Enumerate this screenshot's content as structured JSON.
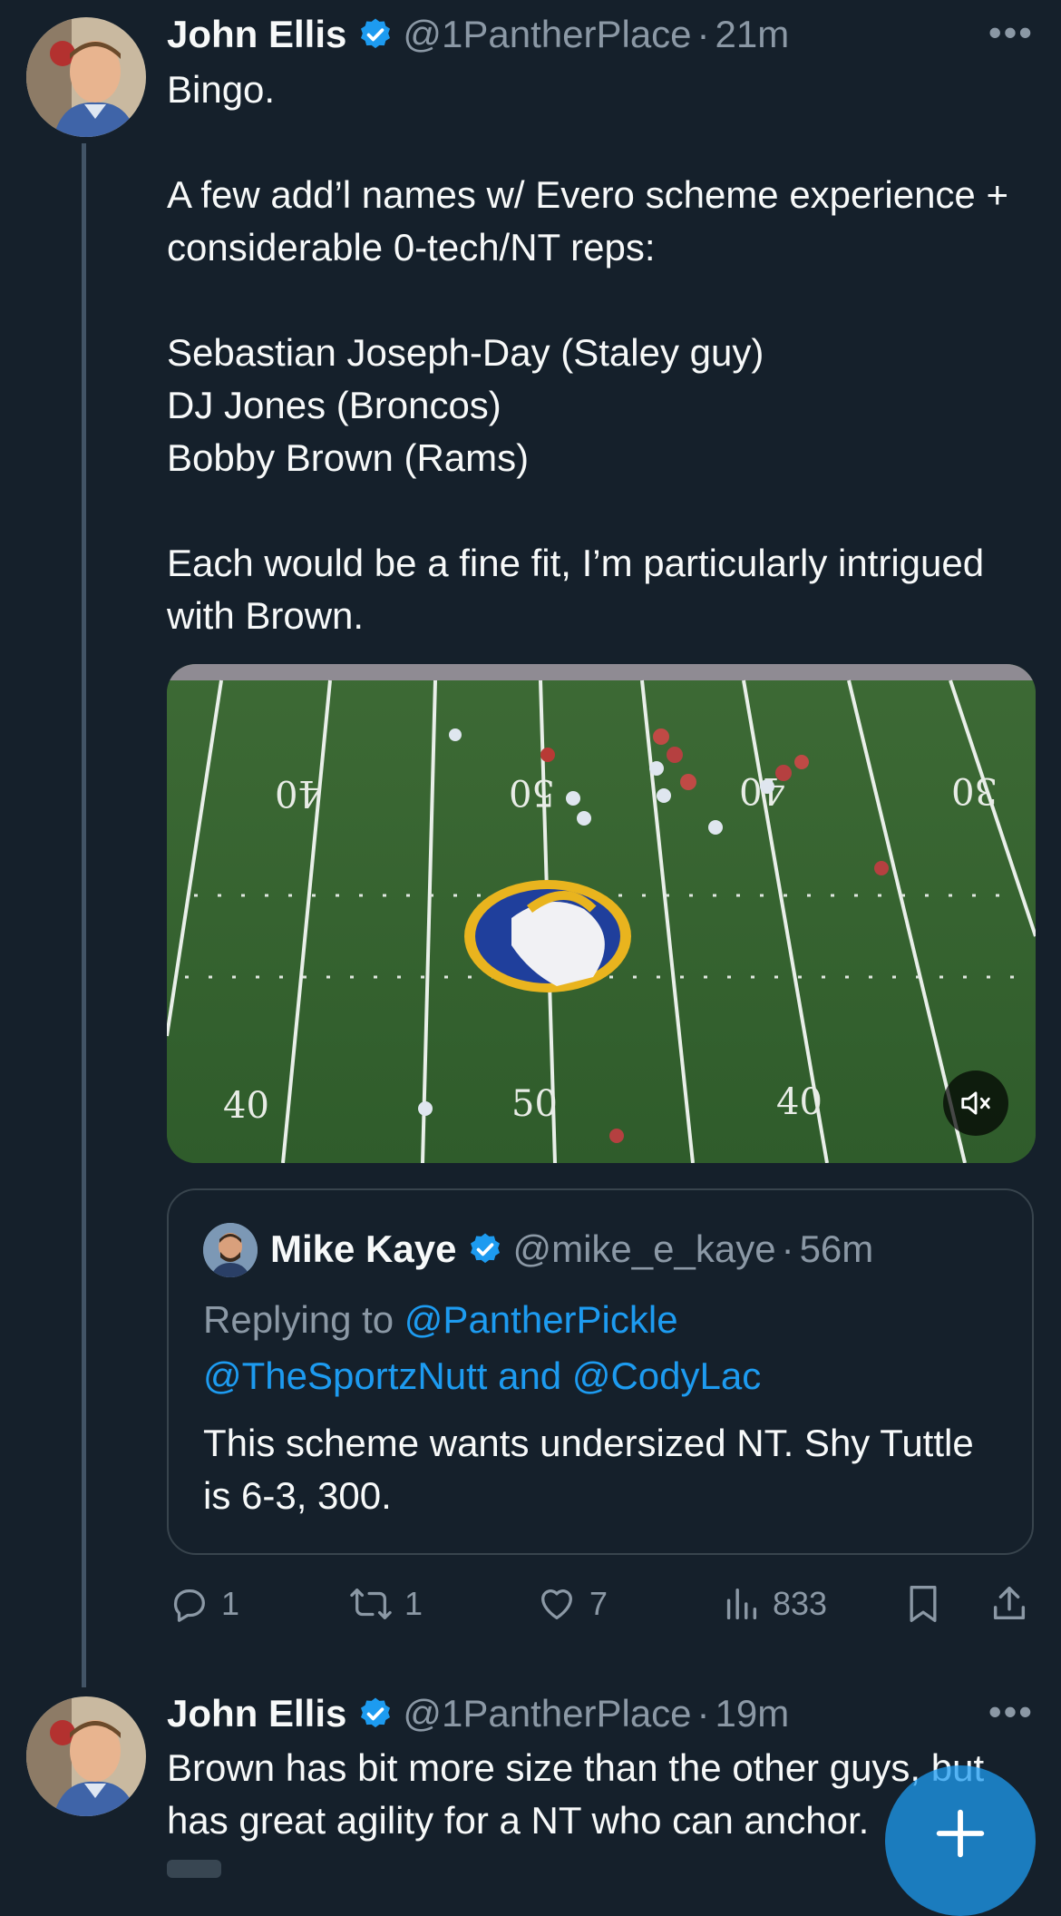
{
  "tweet1": {
    "name": "John Ellis",
    "handle": "@1PantherPlace",
    "separator": "·",
    "time": "21m",
    "more": "•••",
    "text": "Bingo.\n\nA few add’l names w/ Evero scheme experience + considerable 0-tech/NT reps:\n\nSebastian Joseph-Day (Staley guy)\nDJ Jones (Broncos)\nBobby Brown (Rams)\n\nEach would be a fine fit, I’m particularly intrigued with Brown."
  },
  "media": {
    "field_numbers_top": [
      "40",
      "50",
      "40",
      "30"
    ],
    "field_numbers_bottom": [
      "40",
      "50",
      "40"
    ],
    "mute_icon": "speaker-muted-icon"
  },
  "quote": {
    "name": "Mike Kaye",
    "handle": "@mike_e_kaye",
    "separator": "·",
    "time": "56m",
    "replying_prefix": "Replying to",
    "reply_user1": "@PantherPickle",
    "reply_user2": "@TheSportzNutt",
    "reply_and": "and",
    "reply_user3": "@CodyLac",
    "text": "This scheme wants undersized NT. Shy Tuttle is 6-3, 300."
  },
  "actions": {
    "replies": "1",
    "reposts": "1",
    "likes": "7",
    "views": "833"
  },
  "tweet2": {
    "name": "John Ellis",
    "handle": "@1PantherPlace",
    "separator": "·",
    "time": "19m",
    "more": "•••",
    "text": "Brown has bit more size than the other guys, but has great agility for a NT who can anchor."
  },
  "colors": {
    "background": "#15202b",
    "accent": "#1d9bf0",
    "muted": "#8b98a5",
    "thread_line": "#425466"
  }
}
